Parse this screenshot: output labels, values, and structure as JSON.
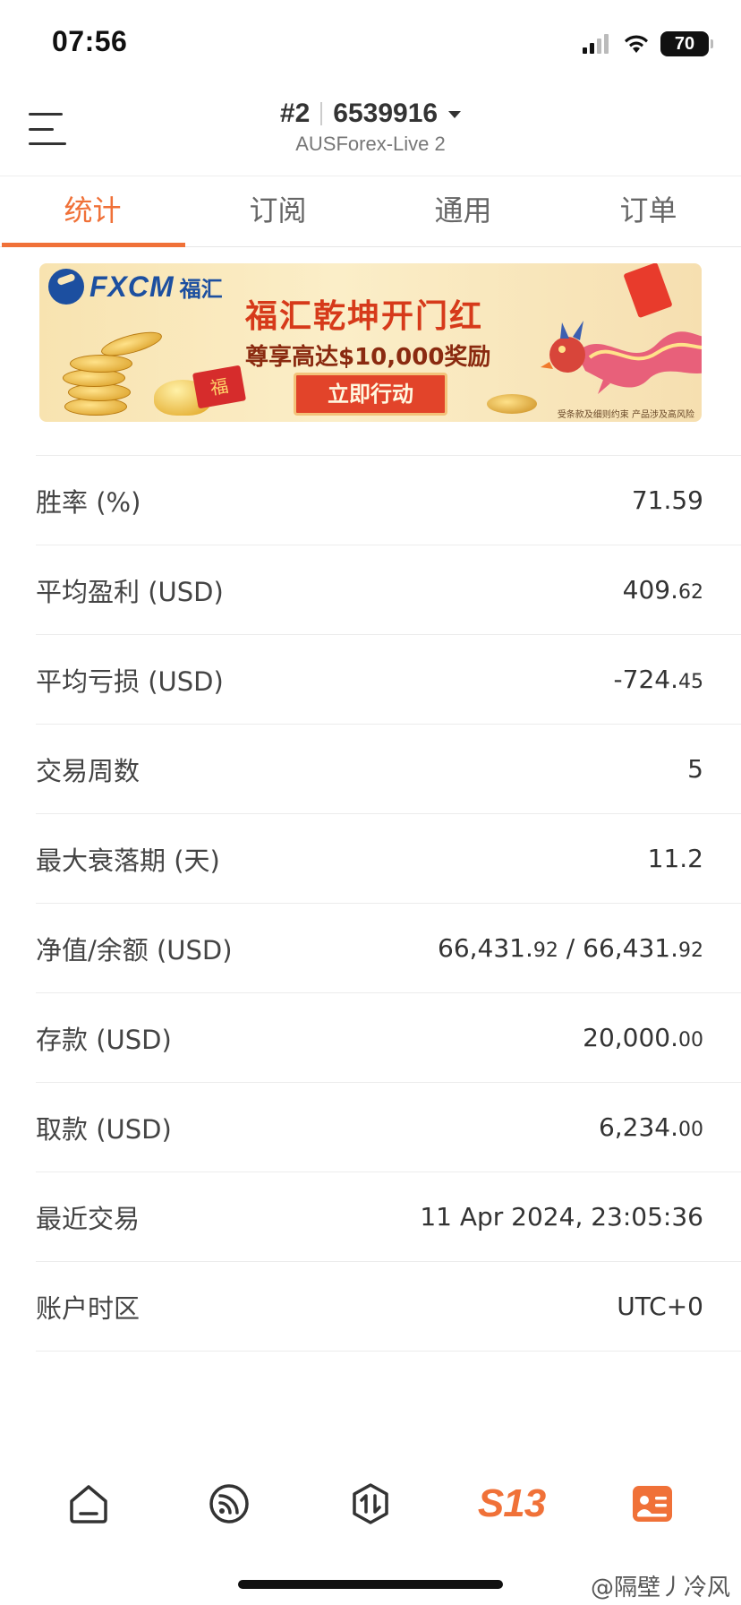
{
  "status_bar": {
    "time": "07:56",
    "battery": "70"
  },
  "header": {
    "account_index": "#2",
    "account_number": "6539916",
    "server": "AUSForex-Live 2"
  },
  "tabs": [
    {
      "label": "统计",
      "active": true
    },
    {
      "label": "订阅",
      "active": false
    },
    {
      "label": "通用",
      "active": false
    },
    {
      "label": "订单",
      "active": false
    }
  ],
  "banner": {
    "brand": "FXCM",
    "brand_cn": "福汇",
    "title": "福汇乾坤开门红",
    "subtitle": "尊享高达$10,000奖励",
    "cta": "立即行动",
    "disclaimer": "受条款及细则约束 产品涉及高风险",
    "packet_char": "福"
  },
  "stats": [
    {
      "label": "胜率 (%)",
      "value": "71.59",
      "frac": ""
    },
    {
      "label": "平均盈利 (USD)",
      "value": "409.",
      "frac": "62"
    },
    {
      "label": "平均亏损 (USD)",
      "value": "-724.",
      "frac": "45"
    },
    {
      "label": "交易周数",
      "value": "5",
      "frac": ""
    },
    {
      "label": "最大衰落期 (天)",
      "value": "11.2",
      "frac": ""
    },
    {
      "label": "净值/余额 (USD)",
      "value": "66,431.",
      "frac": "92",
      "value2": " / 66,431.",
      "frac2": "92"
    },
    {
      "label": "存款 (USD)",
      "value": "20,000.",
      "frac": "00"
    },
    {
      "label": "取款 (USD)",
      "value": "6,234.",
      "frac": "00"
    },
    {
      "label": "最近交易",
      "value": "11 Apr 2024, 23:05:36",
      "frac": ""
    },
    {
      "label": "账户时区",
      "value": "UTC+0",
      "frac": ""
    }
  ],
  "bottom_nav": {
    "items": [
      {
        "icon": "home-icon"
      },
      {
        "icon": "feed-icon"
      },
      {
        "icon": "trade-icon"
      },
      {
        "icon": "s13-logo",
        "label": "S13"
      },
      {
        "icon": "profile-card-icon"
      }
    ],
    "accent": "#f07138"
  },
  "watermark": "@隔壁丿冷风"
}
